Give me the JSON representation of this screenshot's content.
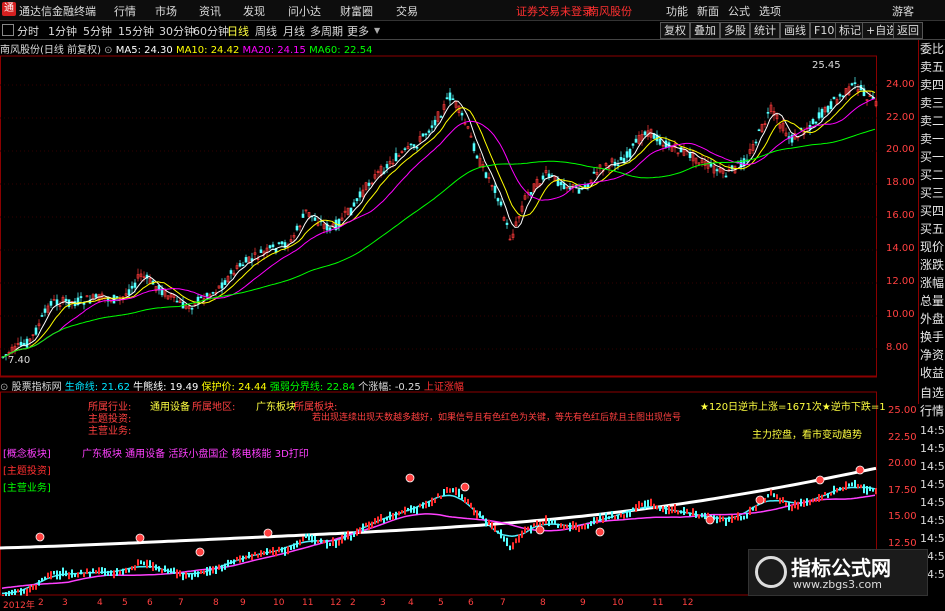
{
  "app": {
    "title": "通达信金融终端"
  },
  "menubar": {
    "items": [
      "行情",
      "市场",
      "资讯",
      "发现",
      "问小达",
      "财富圈",
      "交易"
    ],
    "login_status": "证券交易未登录",
    "stock_name": "南风股份",
    "right_items": [
      "功能",
      "新面",
      "公式",
      "选项"
    ],
    "user": "游客"
  },
  "periods": {
    "items": [
      "分时",
      "1分钟",
      "5分钟",
      "15分钟",
      "30分钟",
      "60分钟",
      "日线",
      "周线",
      "月线",
      "多周期",
      "更多"
    ],
    "active": "日线"
  },
  "toolbar": {
    "buttons": [
      "复权",
      "叠加",
      "多股",
      "统计",
      "画线",
      "F10",
      "标记",
      "+自选",
      "返回"
    ]
  },
  "main_header": {
    "title": "南风股份(日线 前复权)",
    "ma5": "MA5: 24.30",
    "ma10": "MA10: 24.42",
    "ma20": "MA20: 24.15",
    "ma60": "MA60: 22.54",
    "high_label": "25.45",
    "low_label": "7.40",
    "colors": {
      "ma5": "#ffffff",
      "ma10": "#ffff00",
      "ma20": "#ff00ff",
      "ma60": "#00ff00"
    }
  },
  "y_axis_main": [
    "24.00",
    "22.00",
    "20.00",
    "18.00",
    "16.00",
    "14.00",
    "12.00",
    "10.00",
    "8.00"
  ],
  "right_panel": [
    "委比",
    "卖五",
    "卖四",
    "卖三",
    "卖二",
    "卖一",
    "买一",
    "买二",
    "买三",
    "买四",
    "买五",
    "现价",
    "涨跌",
    "涨幅",
    "总量",
    "外盘",
    "换手",
    "净资",
    "收益"
  ],
  "right_panel_bottom": [
    "自选",
    "行情"
  ],
  "ind_header": {
    "name": "股票指标网",
    "lifeline": "生命线: 21.62",
    "bullbear": "牛熊线: 19.49",
    "stop": "保护价: 24.44",
    "strongweak": "强弱分界线: 22.84",
    "daily": "个涨幅: -0.25",
    "market": "上证涨幅"
  },
  "indicator_labels": {
    "industry_label": "所属行业:",
    "industry": "通用设备",
    "region_label": "所属地区:",
    "region": "广东板块",
    "sector_label": "所属板块:",
    "theme_label": "主题投资:",
    "business_label": "主营业务:",
    "concepts": "广东板块 通用设备 活跃小盘国企 核电核能 3D打印",
    "left_tags": [
      "[概念板块]",
      "[主题投资]",
      "[主营业务]"
    ],
    "notice": "若出现连续出现天数越多越好，如果信号且有色红色为关键，等先有色红后就且主图出现信号",
    "stat1": "★120日逆市上涨=1671次★逆市下跌=1",
    "stat2": "主力控盘，看市变动趋势"
  },
  "y_axis_ind": [
    "25.00",
    "22.50",
    "20.00",
    "17.50",
    "15.00",
    "12.50"
  ],
  "y_axis_ind_right": [
    "14:5",
    "14:5",
    "14:5",
    "14:5",
    "14:5",
    "14:5",
    "14:5",
    "14:5",
    "14:5"
  ],
  "x_axis": [
    "2012年",
    "2",
    "3",
    "4",
    "5",
    "6",
    "7",
    "8",
    "9",
    "10",
    "11",
    "12",
    "2",
    "3",
    "4",
    "5",
    "6",
    "7",
    "8",
    "9",
    "10",
    "11",
    "12"
  ],
  "watermark": {
    "title": "指标公式网",
    "url": "www.zbgs3.com"
  }
}
